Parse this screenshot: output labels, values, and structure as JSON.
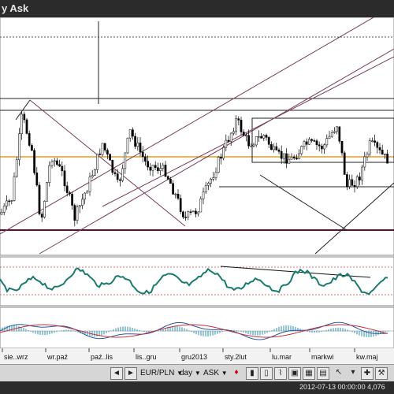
{
  "window": {
    "title": "y Ask"
  },
  "axis": {
    "months": [
      "sie..wrz",
      "wr.paź",
      "paź..lis",
      "lis..gru",
      "gru2013",
      "sty.2lut",
      "lu.mar",
      "markwi",
      "kw.maj"
    ]
  },
  "toolbar": {
    "symbol": "EUR/PLN",
    "period": "day",
    "price_type": "ASK",
    "scroll_left": "◄",
    "scroll_right": "►",
    "dropdown_arrow": "▼"
  },
  "status": {
    "datetime": "2012-07-13 00:00:00",
    "value": "4,076"
  },
  "colors": {
    "candle_up": "#ffffff",
    "candle_down": "#000000",
    "channel_line": "#7a3b5a",
    "horizontal_level": "#d08c00",
    "support_line": "#5a1030",
    "oscillator": "#1a7a6e",
    "macd_signal": "#c0303a",
    "macd_histogram": "#2a8fb0"
  }
}
